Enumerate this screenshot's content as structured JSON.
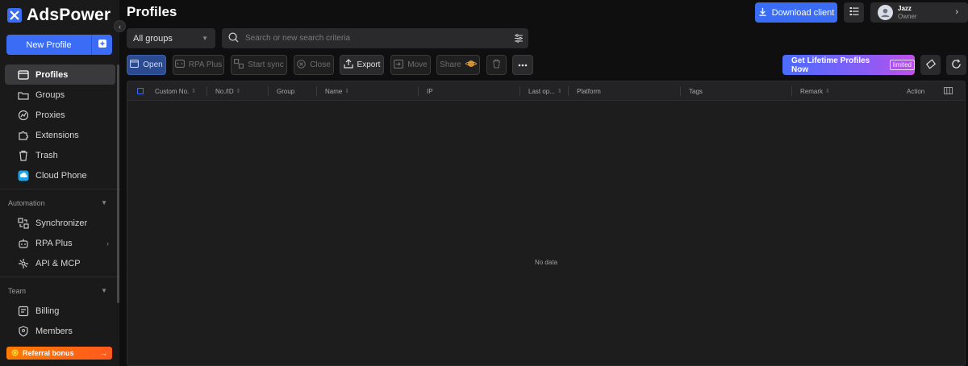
{
  "app": {
    "brand": "AdsPower",
    "page_title": "Profiles"
  },
  "sidebar": {
    "new_profile": "New Profile",
    "items": [
      {
        "label": "Profiles",
        "icon": "profiles-icon",
        "active": true
      },
      {
        "label": "Groups",
        "icon": "groups-icon"
      },
      {
        "label": "Proxies",
        "icon": "proxies-icon"
      },
      {
        "label": "Extensions",
        "icon": "puzzle-icon"
      },
      {
        "label": "Trash",
        "icon": "trash-icon"
      },
      {
        "label": "Cloud Phone",
        "icon": "cloud-phone-icon"
      }
    ],
    "automation": {
      "label": "Automation",
      "items": [
        {
          "label": "Synchronizer",
          "icon": "sync-icon"
        },
        {
          "label": "RPA Plus",
          "icon": "robot-icon",
          "has_submenu": true
        },
        {
          "label": "API & MCP",
          "icon": "api-icon"
        }
      ]
    },
    "team": {
      "label": "Team",
      "items": [
        {
          "label": "Billing",
          "icon": "billing-icon"
        },
        {
          "label": "Members",
          "icon": "shield-icon"
        }
      ]
    },
    "referral": "Referral bonus",
    "referral_arrow": "→"
  },
  "header": {
    "download_client": "Download client",
    "user": {
      "name": "Jazz",
      "role": "Owner"
    }
  },
  "filters": {
    "group_select": "All groups",
    "search_placeholder": "Search or new search criteria"
  },
  "toolbar": {
    "open": "Open",
    "rpa_plus": "RPA Plus",
    "start_sync": "Start sync",
    "close": "Close",
    "export": "Export",
    "move": "Move",
    "share": "Share",
    "promo": "Get Lifetime Profiles Now",
    "promo_badge": "limited"
  },
  "table": {
    "columns": [
      "Custom No.",
      "No./ID",
      "Group",
      "Name",
      "IP",
      "Last op...",
      "Platform",
      "Tags",
      "Remark",
      "Action"
    ],
    "empty_text": "No data"
  },
  "colors": {
    "accent": "#3b6cf6",
    "background": "#0f0f10",
    "sidebar": "#1a1a1b",
    "referral": "#ff7a00"
  }
}
